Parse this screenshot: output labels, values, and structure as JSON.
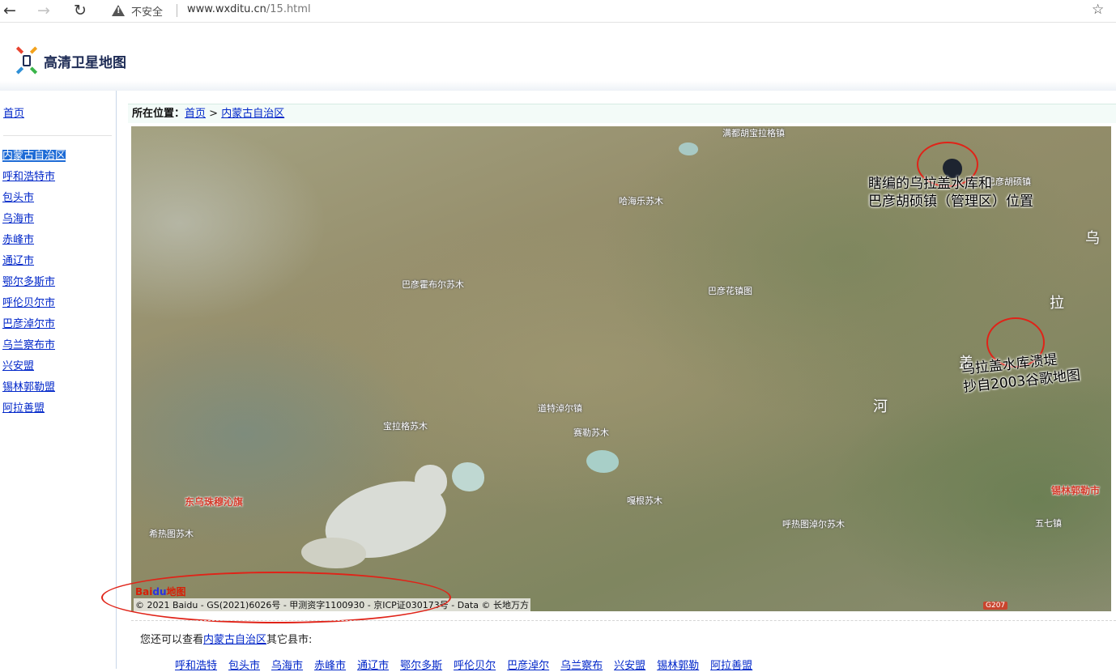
{
  "browser": {
    "security_text": "不安全",
    "url_host": "www.wxditu.cn",
    "url_path": "/15.html"
  },
  "site": {
    "logo_text": "高清卫星地图"
  },
  "sidebar": {
    "home": "首页",
    "items": [
      {
        "label": "内蒙古自治区",
        "active": true
      },
      {
        "label": "呼和浩特市"
      },
      {
        "label": "包头市"
      },
      {
        "label": "乌海市"
      },
      {
        "label": "赤峰市"
      },
      {
        "label": "通辽市"
      },
      {
        "label": "鄂尔多斯市"
      },
      {
        "label": "呼伦贝尔市"
      },
      {
        "label": "巴彦淖尔市"
      },
      {
        "label": "乌兰察布市"
      },
      {
        "label": "兴安盟"
      },
      {
        "label": "锡林郭勒盟"
      },
      {
        "label": "阿拉善盟"
      }
    ]
  },
  "breadcrumb": {
    "prefix": "所在位置：",
    "home": "首页",
    "sep": ">",
    "current": "内蒙古自治区"
  },
  "map": {
    "labels": [
      "满都胡宝拉格镇",
      "巴彦胡硕镇",
      "哈海乐苏木",
      "巴彦霍布尔苏木",
      "巴彦花镇图",
      "道特淖尔镇",
      "宝拉格苏木",
      "赛勒苏木",
      "东乌珠穆沁旗",
      "希热图苏木",
      "嘎根苏木",
      "呼热图淖尔苏木",
      "锡林郭勒市",
      "五七镇"
    ],
    "annotation_1_line1": "瞎编的乌拉盖水库和",
    "annotation_1_line2": "巴彦胡硕镇（管理区）位置",
    "annotation_2_line1": "乌拉盖水库溃堤",
    "annotation_2_line2": "抄自2003谷歌地图",
    "river_chars": [
      "乌",
      "拉",
      "盖",
      "河"
    ],
    "baidu_logo": "Bai",
    "baidu_logo_paw": "du",
    "baidu_logo_suffix": "地图",
    "attribution": "© 2021 Baidu - GS(2021)6026号 - 甲测资字1100930 - 京ICP证030173号 - Data © 长地万方",
    "road_badge": "G207"
  },
  "others": {
    "prefix": "您还可以查看",
    "region": "内蒙古自治区",
    "suffix": "其它县市:",
    "cities": [
      "呼和浩特",
      "包头市",
      "乌海市",
      "赤峰市",
      "通辽市",
      "鄂尔多斯",
      "呼伦贝尔",
      "巴彦淖尔",
      "乌兰察布",
      "兴安盟",
      "锡林郭勒",
      "阿拉善盟"
    ]
  },
  "colors": {
    "link": "#0026c9",
    "active_bg": "#1d6bd6",
    "annotation_circle": "#e02318"
  }
}
